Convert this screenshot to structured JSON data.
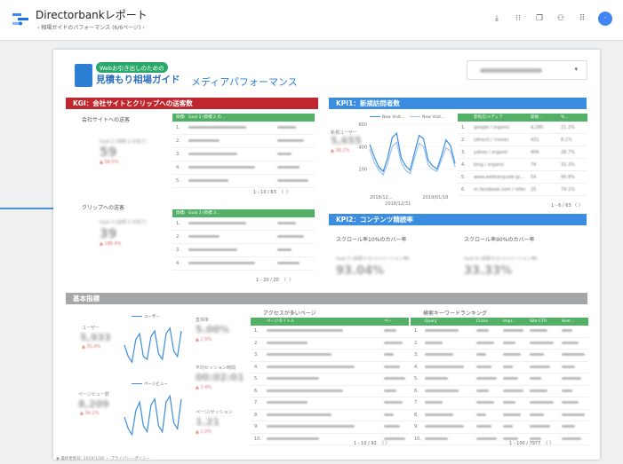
{
  "app": {
    "title": "Directorbankレポート",
    "breadcrumb": "‹ 相場ガイドのパフォーマンス (6/6ページ) ›",
    "toolbar_icons": [
      "download-icon",
      "grid-small-icon",
      "copy-icon",
      "user-add-icon",
      "apps-icon"
    ],
    "avatar_letter": "·"
  },
  "report": {
    "brand_small": "Webお引き出しのための",
    "brand_big": "見積もり相場ガイド",
    "title": "メディアパフォーマンス",
    "date_caret": "▾"
  },
  "kgi": {
    "band": "KGI：会社サイトとクリップへの送客数",
    "company_label": "会社サイトへの送客",
    "company_goal": "Goal 2 (目標 2 の完了)",
    "company_value": "59",
    "company_delta": "▲ 38.5%",
    "company_table_head": [
      "目標の完了場所",
      "Goal 2 (目標 2 の..."
    ],
    "company_table_rows": [
      {
        "n": "1."
      },
      {
        "n": "2."
      },
      {
        "n": "3."
      },
      {
        "n": "4."
      },
      {
        "n": "5."
      }
    ],
    "company_pager": "1 - 10 / 63",
    "clip_label": "クリップへの送客",
    "clip_goal": "Goal 3 (目標 3 の完了)",
    "clip_value": "39",
    "clip_delta": "▲ 186.4%",
    "clip_table_head": [
      "目標の完了場所",
      "Goal 3 (目標 3..."
    ],
    "clip_table_rows": [
      {
        "n": "1."
      },
      {
        "n": "2."
      },
      {
        "n": "3."
      },
      {
        "n": "4."
      }
    ],
    "clip_pager": "1 - 20 / 20"
  },
  "kpi1": {
    "band": "KPI1：新規訪問者数",
    "side_label": "新規ユーザー",
    "side_value": "5,655",
    "side_delta": "▲ 38.2%",
    "legend": [
      "New Visit...",
      "New Visit..."
    ],
    "table_head": [
      "参照元/メディア",
      "新規...",
      "%..."
    ],
    "table_rows": [
      {
        "n": "1.",
        "src": "google / organic",
        "v": "4,295",
        "p": "21.2%"
      },
      {
        "n": "2.",
        "src": "(direct) / (none)",
        "v": "431",
        "p": "8.1%"
      },
      {
        "n": "3.",
        "src": "yahoo / organic",
        "v": "406",
        "p": "28.7%"
      },
      {
        "n": "4.",
        "src": "bing / organic",
        "v": "74",
        "p": "32.3%"
      },
      {
        "n": "5.",
        "src": "www.webtanguide.jp...",
        "v": "54",
        "p": "90.8%"
      },
      {
        "n": "6.",
        "src": "m.facebook.com / refer...",
        "v": "25",
        "p": "74.1%"
      }
    ],
    "pager": "1 - 6 / 63"
  },
  "kpi2": {
    "band": "KPI2：コンテンツ精読率",
    "left_title": "スクロール率10%のカバー率",
    "left_goal": "Goal 5 (目標 5 のコンバージョン率)",
    "left_value": "93.04%",
    "right_title": "スクロール率90%のカバー率",
    "right_goal": "Goal 6 (目標 6 のコンバージョン率)",
    "right_value": "33.33%"
  },
  "basic": {
    "band": "基本指標",
    "users_label": "ユーザー",
    "users_value": "5,933",
    "users_delta": "▲ 35.4%",
    "users_legend": "ユーザー",
    "pv_label": "ページビュー数",
    "pv_value": "8,209",
    "pv_delta": "▲ 34.1%",
    "pv_legend": "ページビュー",
    "bounce_label": "直帰率",
    "bounce_value": "5.00%",
    "bounce_delta": "▲ 2.5%",
    "avgtime_label": "平均セッション時間",
    "avgtime_value": "00:02:01",
    "avgtime_delta": "▲ 3.4%",
    "pps_label": "ページ/セッション",
    "pps_value": "1.21",
    "pps_delta": "▲ 1.0%",
    "pages_title": "アクセスが多いページ",
    "pages_head": [
      "ページタイトル",
      "ペー"
    ],
    "pages_rows": [
      "1.",
      "2.",
      "3.",
      "4.",
      "5.",
      "6.",
      "7.",
      "8.",
      "9.",
      "10."
    ],
    "pages_pager": "1 - 10 / 92",
    "kw_title": "検索キーワードランキング",
    "kw_head": [
      "Query",
      "Clicks",
      "Impr...",
      "Site CTR",
      "Aver..."
    ],
    "kw_rows": [
      "1.",
      "2.",
      "3.",
      "4.",
      "5.",
      "6.",
      "7.",
      "8.",
      "9.",
      "10."
    ],
    "kw_pager": "1 - 100 / 7977"
  },
  "chart_data": [
    {
      "type": "line",
      "title": "",
      "series": [
        {
          "name": "New Visit...",
          "values": [
            420,
            310,
            220,
            180,
            300,
            480,
            520,
            300,
            230,
            190,
            350,
            500,
            470,
            280,
            230,
            200,
            320,
            460,
            410,
            250
          ]
        },
        {
          "name": "New Visit...",
          "values": [
            380,
            260,
            190,
            150,
            250,
            400,
            440,
            260,
            190,
            160,
            300,
            430,
            400,
            240,
            200,
            180,
            280,
            390,
            360,
            220
          ]
        }
      ],
      "x_tick_labels": [
        "2018/12...",
        "2019/01/18",
        "2018/12/31"
      ],
      "y_ticks": [
        200,
        400,
        600
      ],
      "ylim": [
        0,
        600
      ]
    },
    {
      "type": "line",
      "series": [
        {
          "name": "ユーザー",
          "values": [
            60,
            40,
            30,
            70,
            80,
            40,
            35,
            75,
            85,
            45,
            35,
            80,
            90,
            50,
            40,
            85
          ]
        }
      ]
    },
    {
      "type": "line",
      "series": [
        {
          "name": "ページビュー",
          "values": [
            60,
            40,
            30,
            70,
            85,
            45,
            35,
            80,
            90,
            45,
            35,
            85,
            95,
            50,
            40,
            90
          ]
        }
      ]
    }
  ],
  "footer": "◉ 最終更新日: 2019/1/28 ・ プライバシーポリシー",
  "colors": {
    "kgi": "#c0262d",
    "kpi": "#3a8de0",
    "table_head": "#52b067",
    "line1": "#3a8de0",
    "line2": "#9cc3ec"
  }
}
